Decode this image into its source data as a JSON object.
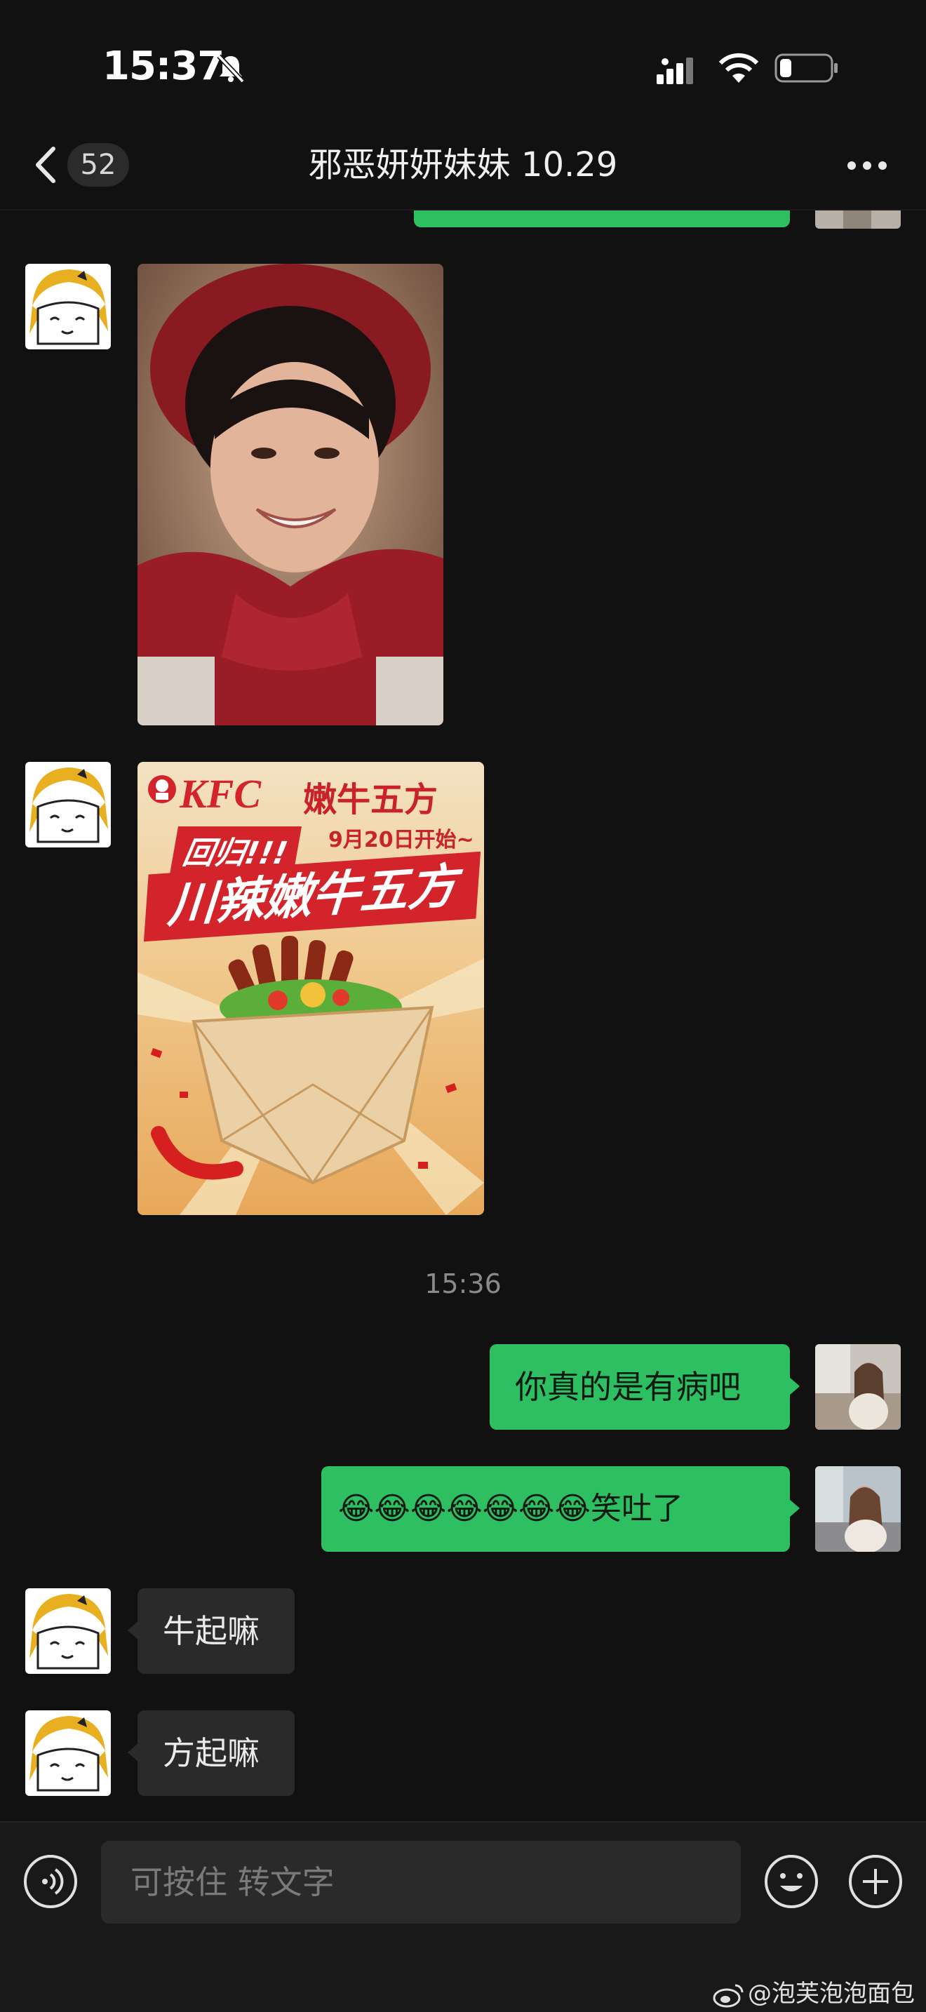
{
  "status_bar": {
    "time": "15:37",
    "icons": [
      "bell-slash-icon",
      "cellular-signal-icon",
      "wifi-icon",
      "battery-icon"
    ]
  },
  "nav": {
    "back_icon": "chevron-left-icon",
    "unread_count": "52",
    "title": "邪恶妍妍妹妹 10.29",
    "more_icon": "more-dots-icon"
  },
  "messages": {
    "poster": {
      "brand": "KFC",
      "top_line": "嫩牛五方",
      "return_tag": "回归!!!",
      "date_line": "9月20日开始~",
      "headline": "川辣嫩牛五方"
    },
    "timestamp": "15:36",
    "sent_1": "你真的是有病吧",
    "sent_2": "😂😂😂😂😂😂😂笑吐了",
    "recv_1": "牛起嘛",
    "recv_2": "方起嘛"
  },
  "input_bar": {
    "placeholder": "可按住 转文字",
    "voice_icon": "voice-icon",
    "emoji_icon": "emoji-icon",
    "plus_icon": "plus-icon"
  },
  "watermark": "@泡芙泡泡面包",
  "colors": {
    "background": "#111111",
    "sent_bubble": "#2fbf63",
    "received_bubble": "#2a2a2a",
    "kfc_red": "#d3242b"
  }
}
